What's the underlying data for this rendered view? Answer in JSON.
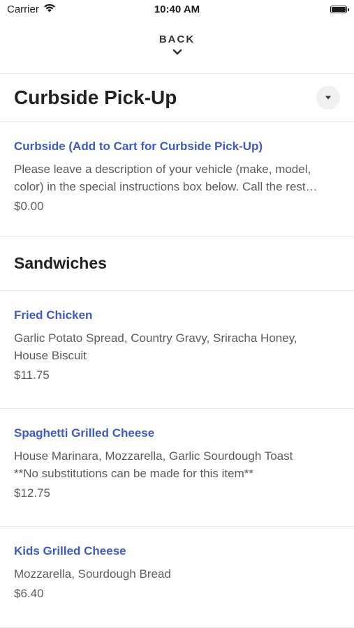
{
  "status_bar": {
    "carrier": "Carrier",
    "time": "10:40 AM",
    "icons": [
      "wifi-icon",
      "battery-icon"
    ]
  },
  "nav": {
    "back_label": "BACK",
    "back_icon": "chevron-down-icon"
  },
  "section": {
    "title": "Curbside Pick-Up",
    "dropdown_icon": "caret-down-icon"
  },
  "curbside_item": {
    "name": "Curbside (Add to Cart for Curbside Pick-Up)",
    "description_lines": [
      "Please leave a description of your vehicle (make, model,",
      "color) in the special instructions box below. Call the rest…"
    ],
    "price": "$0.00"
  },
  "group": {
    "title": "Sandwiches",
    "items": [
      {
        "name": "Fried Chicken",
        "description_lines": [
          "Garlic Potato Spread, Country Gravy, Sriracha Honey,",
          "House Biscuit"
        ],
        "price": "$11.75"
      },
      {
        "name": "Spaghetti Grilled Cheese",
        "description_lines": [
          "House Marinara, Mozzarella, Garlic Sourdough Toast",
          "**No substitutions can be made for this item**"
        ],
        "price": "$12.75"
      },
      {
        "name": "Kids Grilled Cheese",
        "description_lines": [
          "Mozzarella, Sourdough Bread"
        ],
        "price": "$6.40"
      }
    ]
  },
  "colors": {
    "link": "#3f5bc2",
    "text_secondary": "#5c5c5c",
    "divider": "#e6e6e6"
  }
}
